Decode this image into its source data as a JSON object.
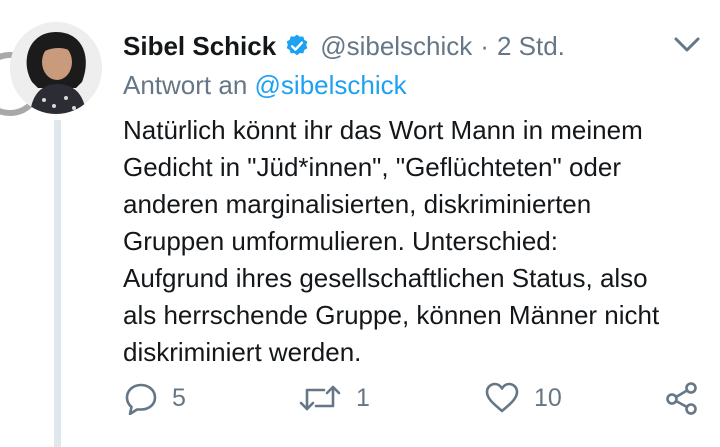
{
  "tweet": {
    "name": "Sibel Schick",
    "handle": "@sibelschick",
    "separator": "·",
    "time": "2 Std.",
    "reply_prefix": "Antwort an",
    "reply_to": "@sibelschick",
    "text": "Natürlich könnt ihr das Wort Mann in meinem\nGedicht in \"Jüd*innen\", \"Geflüchteten\" oder\nanderen marginalisierten, diskriminierten\nGruppen umformulieren. Unterschied:\nAufgrund ihres gesellschaftlichen Status, also\nals herrschende Gruppe, können Männer nicht\ndiskriminiert werden."
  },
  "actions": {
    "reply_count": "5",
    "retweet_count": "1",
    "like_count": "10"
  },
  "icons": {
    "verified": "verified-badge-icon",
    "menu": "chevron-down-icon",
    "reply": "reply-bubble-icon",
    "retweet": "retweet-icon",
    "like": "heart-icon",
    "share": "share-icon"
  },
  "colors": {
    "text": "#14171a",
    "muted": "#657786",
    "accent": "#1da1f2",
    "thread_line": "#e1e8ed"
  }
}
